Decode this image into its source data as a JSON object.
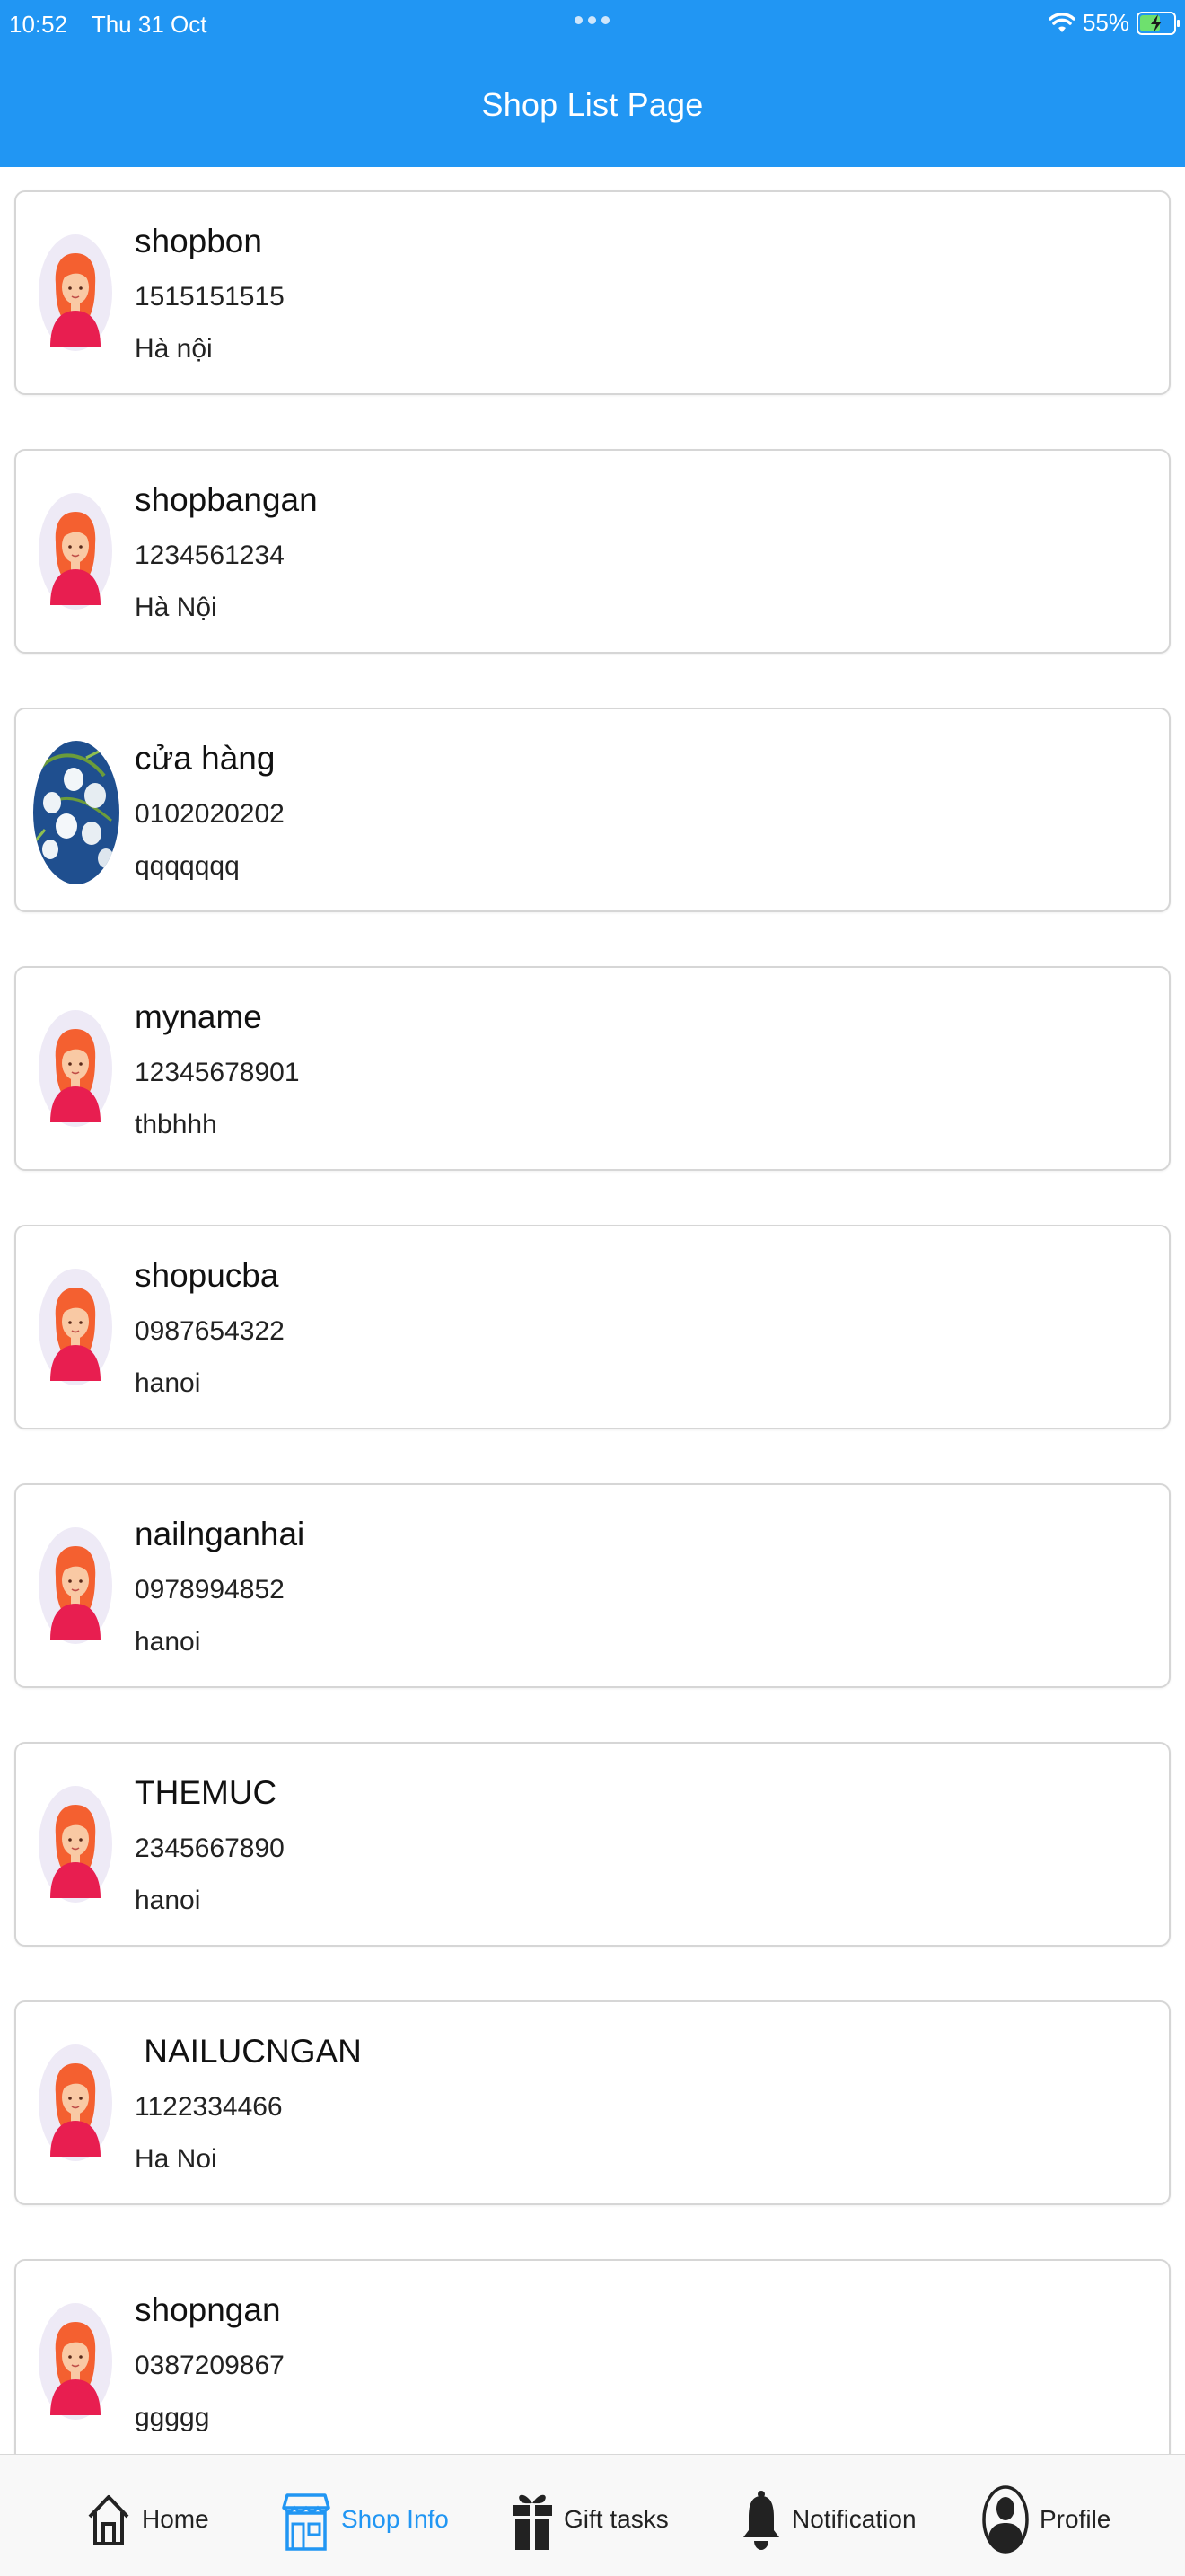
{
  "status_bar": {
    "time": "10:52",
    "date": "Thu 31 Oct",
    "battery": "55%"
  },
  "header": {
    "title": "Shop List Page"
  },
  "shops": [
    {
      "name": "shopbon",
      "phone": "1515151515",
      "address": "Hà nội",
      "avatar": "default-avatar"
    },
    {
      "name": "shopbangan",
      "phone": "1234561234",
      "address": "Hà Nội",
      "avatar": "default-avatar"
    },
    {
      "name": "cửa hàng",
      "phone": "0102020202",
      "address": "qqqqqqq",
      "avatar": "flower-photo"
    },
    {
      "name": "myname",
      "phone": "12345678901",
      "address": "thbhhh",
      "avatar": "default-avatar"
    },
    {
      "name": "shopucba",
      "phone": "0987654322",
      "address": "hanoi",
      "avatar": "default-avatar"
    },
    {
      "name": "nailnganhai",
      "phone": "0978994852",
      "address": "hanoi",
      "avatar": "default-avatar"
    },
    {
      "name": "THEMUC",
      "phone": "2345667890",
      "address": "hanoi",
      "avatar": "default-avatar"
    },
    {
      "name": " NAILUCNGAN",
      "phone": "1122334466",
      "address": "Ha Noi",
      "avatar": "default-avatar"
    },
    {
      "name": "shopngan",
      "phone": "0387209867",
      "address": "ggggg",
      "avatar": "default-avatar"
    }
  ],
  "tabs": [
    {
      "label": "Home",
      "icon": "home-icon",
      "active": false
    },
    {
      "label": "Shop Info",
      "icon": "shop-icon",
      "active": true
    },
    {
      "label": "Gift tasks",
      "icon": "gift-icon",
      "active": false
    },
    {
      "label": "Notification",
      "icon": "bell-icon",
      "active": false
    },
    {
      "label": "Profile",
      "icon": "profile-icon",
      "active": false
    }
  ],
  "colors": {
    "header": "#2196F3",
    "active_tab": "#2196F3",
    "card_border": "#d6d6d6"
  }
}
